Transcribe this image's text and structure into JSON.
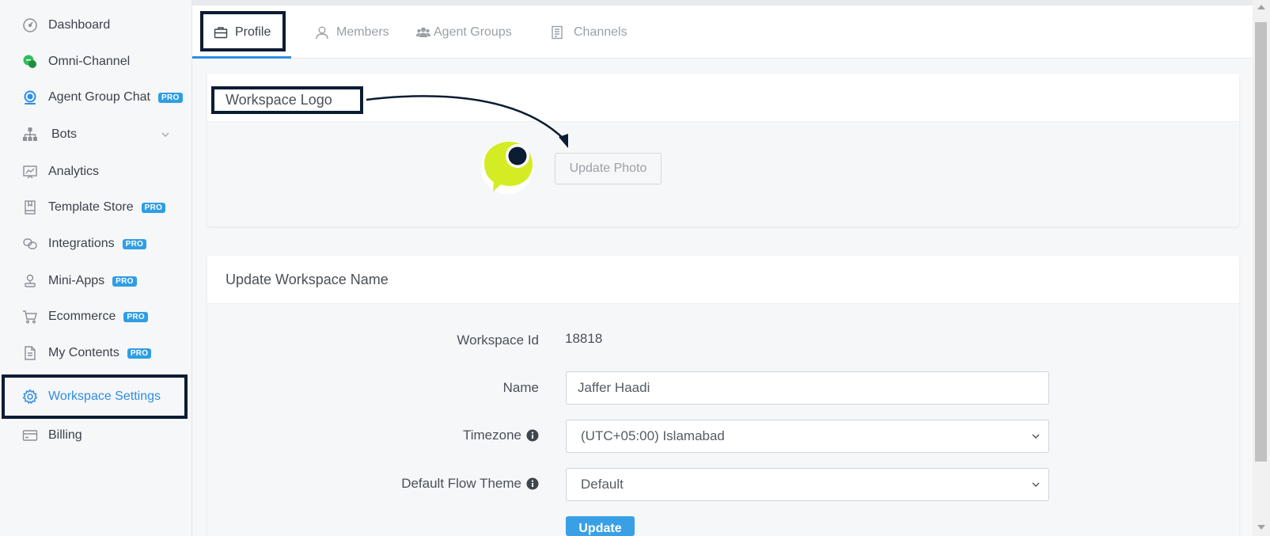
{
  "sidebar": {
    "items": [
      {
        "label": "Dashboard",
        "icon": "dashboard-icon"
      },
      {
        "label": "Omni-Channel",
        "icon": "omni-channel-icon"
      },
      {
        "label": "Agent Group Chat",
        "icon": "agent-chat-icon",
        "badge": "PRO"
      },
      {
        "label": "Bots",
        "icon": "bots-icon"
      },
      {
        "label": "Analytics",
        "icon": "analytics-icon"
      },
      {
        "label": "Template Store",
        "icon": "template-icon",
        "badge": "PRO"
      },
      {
        "label": "Integrations",
        "icon": "integrations-icon",
        "badge": "PRO"
      },
      {
        "label": "Mini-Apps",
        "icon": "mini-apps-icon",
        "badge": "PRO"
      },
      {
        "label": "Ecommerce",
        "icon": "cart-icon",
        "badge": "PRO"
      },
      {
        "label": "My Contents",
        "icon": "document-icon",
        "badge": "PRO"
      },
      {
        "label": "Workspace Settings",
        "icon": "gear-icon",
        "active": true
      },
      {
        "label": "Billing",
        "icon": "card-icon"
      }
    ]
  },
  "tabs": [
    {
      "label": "Profile",
      "icon": "briefcase-icon",
      "active": true
    },
    {
      "label": "Members",
      "icon": "user-icon"
    },
    {
      "label": "Agent Groups",
      "icon": "users-icon"
    },
    {
      "label": "Channels",
      "icon": "channels-icon"
    }
  ],
  "logo_card": {
    "title": "Workspace Logo",
    "button": "Update Photo"
  },
  "name_card": {
    "title": "Update Workspace Name",
    "id_label": "Workspace Id",
    "id_value": "18818",
    "name_label": "Name",
    "name_value": "Jaffer Haadi",
    "timezone_label": "Timezone",
    "timezone_value": "(UTC+05:00) Islamabad",
    "theme_label": "Default Flow Theme",
    "theme_value": "Default",
    "update_button": "Update"
  },
  "colors": {
    "accent": "#2f8de4",
    "pro_badge": "#2f9ee4",
    "annotation": "#0b1c33",
    "logo_green": "#d4ec23"
  }
}
